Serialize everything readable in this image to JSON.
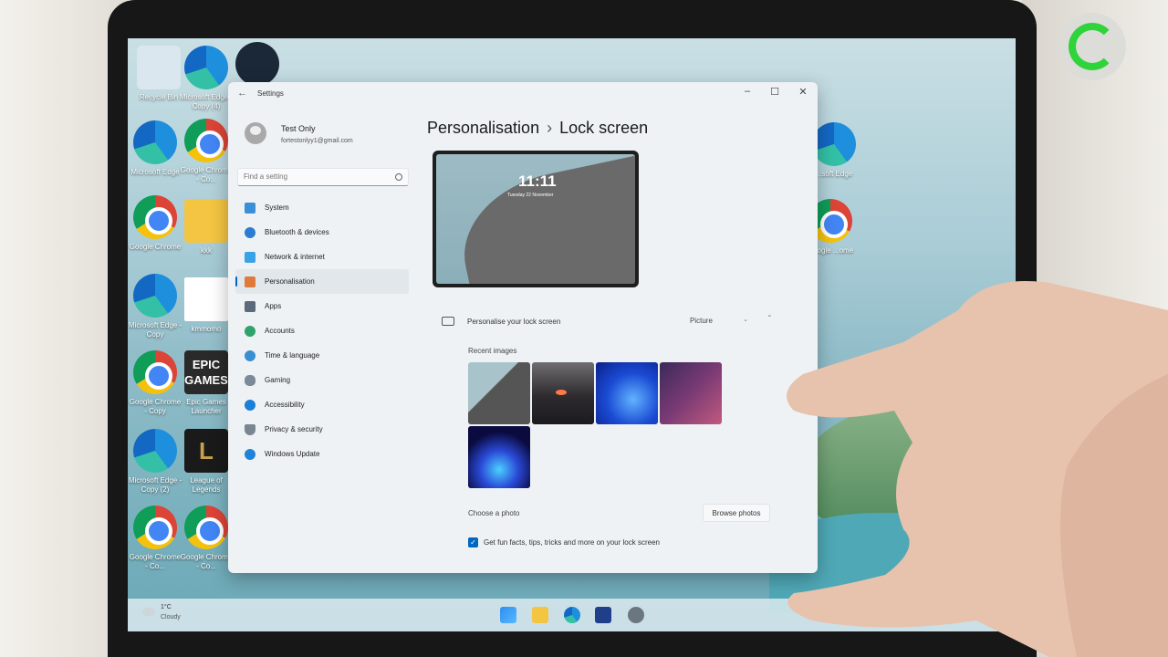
{
  "desktop": {
    "icons": [
      {
        "label": "Recycle Bin"
      },
      {
        "label": "Microsoft Edge - Copy (4)"
      },
      {
        "label": ""
      },
      {
        "label": "Microsoft Edge"
      },
      {
        "label": "Google Chrome - Co..."
      },
      {
        "label": "Google Chrome"
      },
      {
        "label": "kkk"
      },
      {
        "label": "Microsoft Edge - Copy"
      },
      {
        "label": "kmmomo"
      },
      {
        "label": "Google Chrome - Copy"
      },
      {
        "label": "Epic Games Launcher"
      },
      {
        "label": "Microsoft Edge - Copy (2)"
      },
      {
        "label": "League of Legends"
      },
      {
        "label": "Google Chrome - Co..."
      },
      {
        "label": "Google Chrome - Co..."
      },
      {
        "label": "...soft Edge"
      },
      {
        "label": "Google ...ome"
      }
    ],
    "epic_text": "EPIC GAMES",
    "lol_text": "L"
  },
  "window": {
    "title": "Settings",
    "controls": {
      "minimize": "–",
      "maximize": "☐",
      "close": "✕"
    }
  },
  "user": {
    "name": "Test Only",
    "email": "fortestonlyy1@gmail.com"
  },
  "search": {
    "placeholder": "Find a setting"
  },
  "nav": [
    {
      "label": "System",
      "color": "#3b8fd6"
    },
    {
      "label": "Bluetooth & devices",
      "color": "#2b7cd3"
    },
    {
      "label": "Network & internet",
      "color": "#3aa2e6"
    },
    {
      "label": "Personalisation",
      "color": "#e07a3a"
    },
    {
      "label": "Apps",
      "color": "#5a6a7a"
    },
    {
      "label": "Accounts",
      "color": "#2fa36b"
    },
    {
      "label": "Time & language",
      "color": "#3a8fd0"
    },
    {
      "label": "Gaming",
      "color": "#7a8a99"
    },
    {
      "label": "Accessibility",
      "color": "#1a7fd6"
    },
    {
      "label": "Privacy & security",
      "color": "#7a8592"
    },
    {
      "label": "Windows Update",
      "color": "#1f84d9"
    }
  ],
  "breadcrumb": {
    "parent": "Personalisation",
    "separator": "›",
    "current": "Lock screen"
  },
  "preview": {
    "time": "11:11",
    "date": "Tuesday 22 November"
  },
  "lock_screen": {
    "label": "Personalise your lock screen",
    "dropdown_value": "Picture",
    "recent_images_label": "Recent images",
    "choose_photo_label": "Choose a photo",
    "browse_button": "Browse photos",
    "fun_facts_label": "Get fun facts, tips, tricks and more on your lock screen",
    "fun_facts_checked": true
  },
  "taskbar": {
    "temp": "1°C",
    "weather": "Cloudy"
  },
  "colors": {
    "accent": "#0067c0",
    "window_bg": "#eef2f5"
  }
}
